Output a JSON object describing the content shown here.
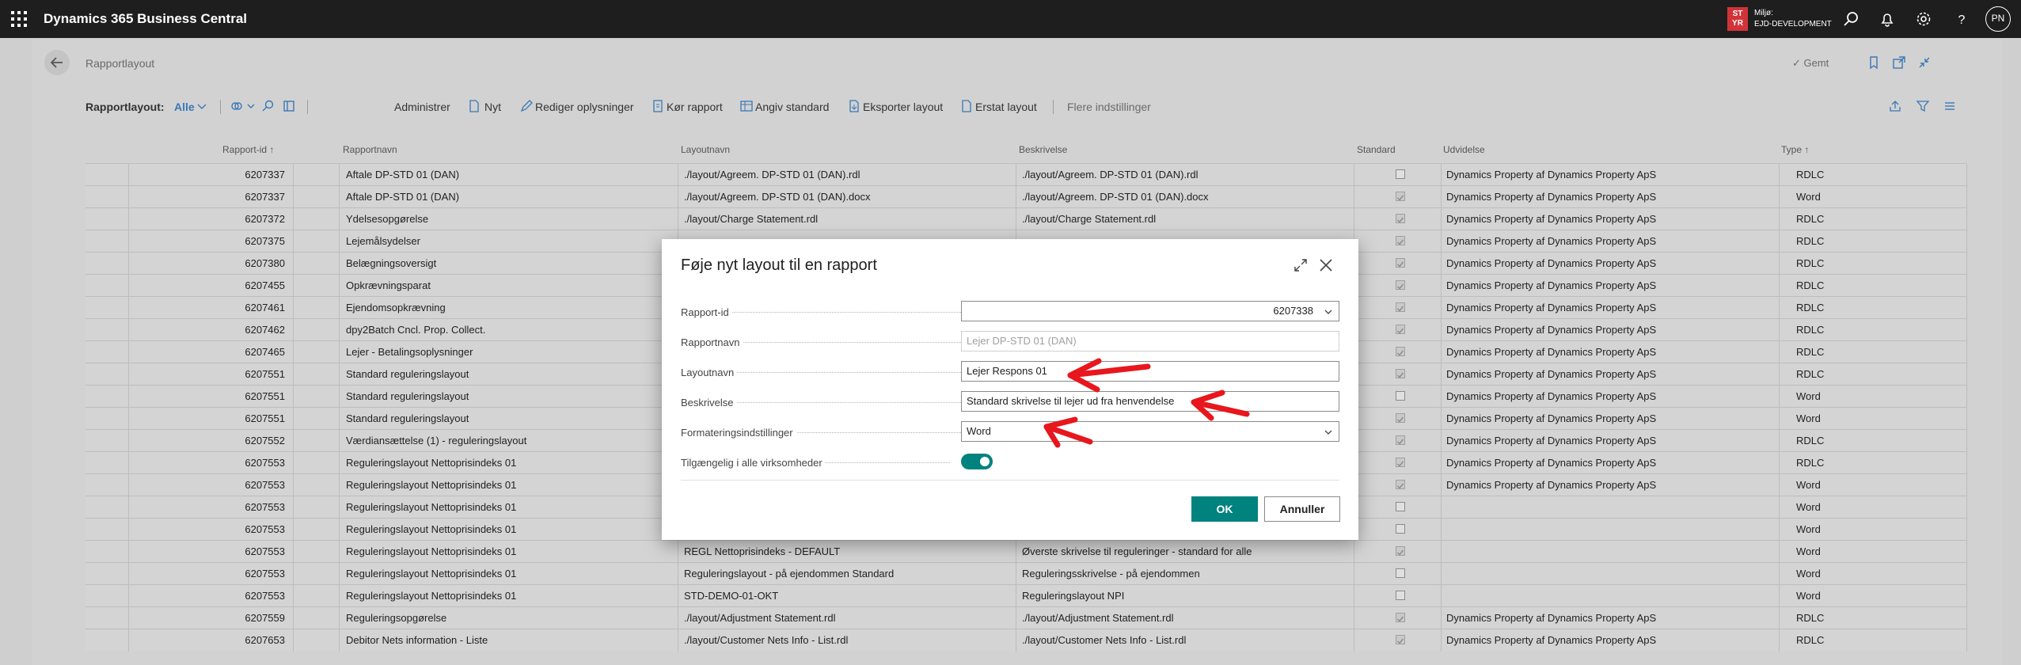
{
  "app": {
    "title": "Dynamics 365 Business Central",
    "env_badge_line1": "ST",
    "env_badge_line2": "YR",
    "env_label": "Miljø:",
    "env_name": "EJD-DEVELOPMENT",
    "user_initials": "PN",
    "icons": [
      "waffle-icon",
      "search-icon",
      "bell-icon",
      "gear-icon",
      "help-icon"
    ]
  },
  "page": {
    "title": "Rapportlayout",
    "saved_label": "✓ Gemt"
  },
  "actionbar": {
    "filter_label": "Rapportlayout:",
    "filter_value": "Alle",
    "administrer": "Administrer",
    "nyt": "Nyt",
    "rediger": "Rediger oplysninger",
    "koer": "Kør rapport",
    "angiv": "Angiv standard",
    "eksporter": "Eksporter layout",
    "erstat": "Erstat layout",
    "flere": "Flere indstillinger"
  },
  "table": {
    "headers": {
      "rapport_id": "Rapport-id ↑",
      "rapportnavn": "Rapportnavn",
      "layoutnavn": "Layoutnavn",
      "beskrivelse": "Beskrivelse",
      "standard": "Standard",
      "udvidelse": "Udvidelse",
      "type": "Type ↑"
    },
    "rows": [
      {
        "id": "6207337",
        "name": "Aftale DP-STD 01 (DAN)",
        "layout": "./layout/Agreem. DP-STD 01 (DAN).rdl",
        "desc": "./layout/Agreem. DP-STD 01 (DAN).rdl",
        "std": false,
        "ext": "Dynamics Property af Dynamics Property ApS",
        "type": "RDLC"
      },
      {
        "id": "6207337",
        "name": "Aftale DP-STD 01 (DAN)",
        "layout": "./layout/Agreem. DP-STD 01 (DAN).docx",
        "desc": "./layout/Agreem. DP-STD 01 (DAN).docx",
        "std": true,
        "ext": "Dynamics Property af Dynamics Property ApS",
        "type": "Word"
      },
      {
        "id": "6207372",
        "name": "Ydelsesopgørelse",
        "layout": "./layout/Charge Statement.rdl",
        "desc": "./layout/Charge Statement.rdl",
        "std": true,
        "ext": "Dynamics Property af Dynamics Property ApS",
        "type": "RDLC"
      },
      {
        "id": "6207375",
        "name": "Lejemålsydelser",
        "layout": "",
        "desc": "",
        "std": true,
        "ext": "Dynamics Property af Dynamics Property ApS",
        "type": "RDLC"
      },
      {
        "id": "6207380",
        "name": "Belægningsoversigt",
        "layout": "",
        "desc": "",
        "std": true,
        "ext": "Dynamics Property af Dynamics Property ApS",
        "type": "RDLC"
      },
      {
        "id": "6207455",
        "name": "Opkrævningsparat",
        "layout": "",
        "desc": "",
        "std": true,
        "ext": "Dynamics Property af Dynamics Property ApS",
        "type": "RDLC"
      },
      {
        "id": "6207461",
        "name": "Ejendomsopkrævning",
        "layout": "",
        "desc": "",
        "std": true,
        "ext": "Dynamics Property af Dynamics Property ApS",
        "type": "RDLC"
      },
      {
        "id": "6207462",
        "name": "dpy2Batch Cncl. Prop. Collect.",
        "layout": "",
        "desc": "",
        "std": true,
        "ext": "Dynamics Property af Dynamics Property ApS",
        "type": "RDLC"
      },
      {
        "id": "6207465",
        "name": "Lejer - Betalingsoplysninger",
        "layout": "",
        "desc": "",
        "std": true,
        "ext": "Dynamics Property af Dynamics Property ApS",
        "type": "RDLC"
      },
      {
        "id": "6207551",
        "name": "Standard reguleringslayout",
        "layout": "",
        "desc": "",
        "std": true,
        "ext": "Dynamics Property af Dynamics Property ApS",
        "type": "RDLC"
      },
      {
        "id": "6207551",
        "name": "Standard reguleringslayout",
        "layout": "",
        "desc": "",
        "std": false,
        "ext": "Dynamics Property af Dynamics Property ApS",
        "type": "Word"
      },
      {
        "id": "6207551",
        "name": "Standard reguleringslayout",
        "layout": "",
        "desc": "",
        "std": true,
        "ext": "Dynamics Property af Dynamics Property ApS",
        "type": "Word"
      },
      {
        "id": "6207552",
        "name": "Værdiansættelse (1) - reguleringslayout",
        "layout": "",
        "desc": "",
        "std": true,
        "ext": "Dynamics Property af Dynamics Property ApS",
        "type": "RDLC"
      },
      {
        "id": "6207553",
        "name": "Reguleringslayout Nettoprisindeks 01",
        "layout": "",
        "desc": "",
        "std": true,
        "ext": "Dynamics Property af Dynamics Property ApS",
        "type": "RDLC"
      },
      {
        "id": "6207553",
        "name": "Reguleringslayout Nettoprisindeks 01",
        "layout": "",
        "desc": "",
        "std": true,
        "ext": "Dynamics Property af Dynamics Property ApS",
        "type": "Word"
      },
      {
        "id": "6207553",
        "name": "Reguleringslayout Nettoprisindeks 01",
        "layout": "",
        "desc": "",
        "std": false,
        "ext": "",
        "type": "Word"
      },
      {
        "id": "6207553",
        "name": "Reguleringslayout Nettoprisindeks 01",
        "layout": "",
        "desc": "",
        "std": false,
        "ext": "",
        "type": "Word"
      },
      {
        "id": "6207553",
        "name": "Reguleringslayout Nettoprisindeks 01",
        "layout": "REGL Nettoprisindeks - DEFAULT",
        "desc": "Øverste skrivelse til reguleringer - standard for alle",
        "std": true,
        "ext": "",
        "type": "Word"
      },
      {
        "id": "6207553",
        "name": "Reguleringslayout Nettoprisindeks 01",
        "layout": "Reguleringslayout - på ejendommen Standard",
        "desc": "Reguleringsskrivelse - på ejendommen",
        "std": false,
        "ext": "",
        "type": "Word"
      },
      {
        "id": "6207553",
        "name": "Reguleringslayout Nettoprisindeks 01",
        "layout": "STD-DEMO-01-OKT",
        "desc": "Reguleringslayout NPI",
        "std": false,
        "ext": "",
        "type": "Word"
      },
      {
        "id": "6207559",
        "name": "Reguleringsopgørelse",
        "layout": "./layout/Adjustment Statement.rdl",
        "desc": "./layout/Adjustment Statement.rdl",
        "std": true,
        "ext": "Dynamics Property af Dynamics Property ApS",
        "type": "RDLC"
      },
      {
        "id": "6207653",
        "name": "Debitor Nets information - Liste",
        "layout": "./layout/Customer Nets Info - List.rdl",
        "desc": "./layout/Customer Nets Info - List.rdl",
        "std": true,
        "ext": "Dynamics Property af Dynamics Property ApS",
        "type": "RDLC"
      }
    ]
  },
  "dialog": {
    "title": "Føje nyt layout til en rapport",
    "rapport_id_label": "Rapport-id",
    "rapport_id_value": "6207338",
    "rapportnavn_label": "Rapportnavn",
    "rapportnavn_value": "Lejer DP-STD 01 (DAN)",
    "layoutnavn_label": "Layoutnavn",
    "layoutnavn_value": "Lejer Respons 01",
    "beskrivelse_label": "Beskrivelse",
    "beskrivelse_value": "Standard skrivelse til lejer ud fra henvendelse",
    "format_label": "Formateringsindstillinger",
    "format_value": "Word",
    "tilgaengelig_label": "Tilgængelig i alle virksomheder",
    "tilgaengelig_on": true,
    "ok_label": "OK",
    "cancel_label": "Annuller"
  },
  "colors": {
    "topbar": "#1e1e1e",
    "accent": "#00827f",
    "env_badge": "#d13438",
    "annotation_arrow": "#e8161d"
  }
}
